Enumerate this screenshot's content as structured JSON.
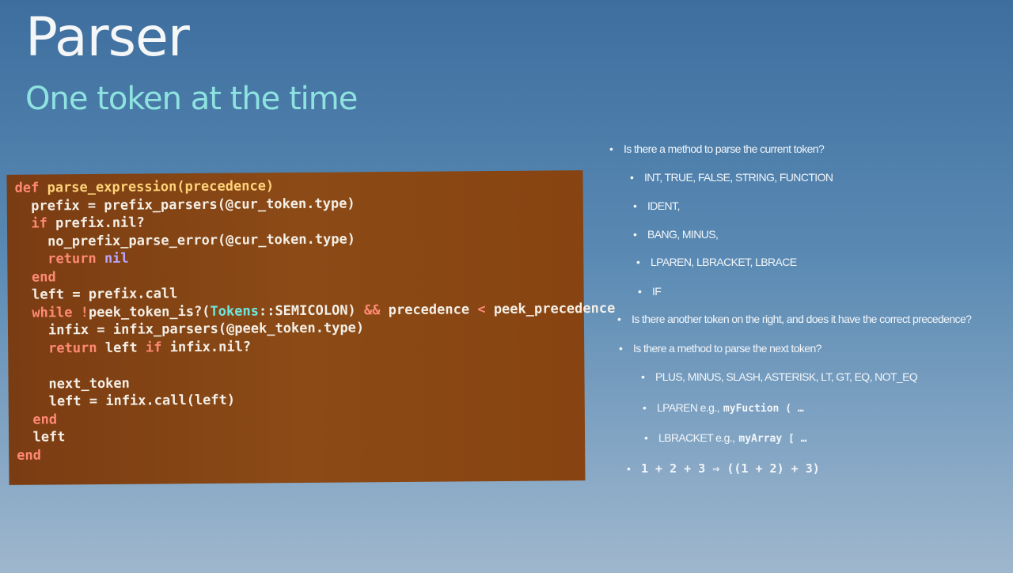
{
  "slide": {
    "title": "Parser",
    "subtitle": "One token at the time"
  },
  "colors": {
    "title": "#f4f6f8",
    "subtitle": "#8ee3e0",
    "code_background": "#8b4a16",
    "keyword": "#ff8a73",
    "function": "#ffd37a",
    "constant": "#6ee7e0",
    "nil": "#b9a6ff"
  },
  "code": [
    [
      {
        "t": "def ",
        "c": "kw"
      },
      {
        "t": "parse_expression(precedence)",
        "c": "fn"
      }
    ],
    [
      {
        "t": "  prefix = prefix_parsers(@cur_token.type)"
      }
    ],
    [
      {
        "t": "  if ",
        "c": "kw"
      },
      {
        "t": "prefix.nil?"
      }
    ],
    [
      {
        "t": "    no_prefix_parse_error(@cur_token.type)"
      }
    ],
    [
      {
        "t": "    return ",
        "c": "kw"
      },
      {
        "t": "nil",
        "c": "nl"
      }
    ],
    [
      {
        "t": "  end",
        "c": "kw"
      }
    ],
    [
      {
        "t": "  left = prefix.call"
      }
    ],
    [
      {
        "t": "  while ",
        "c": "kw"
      },
      {
        "t": "!",
        "c": "kw"
      },
      {
        "t": "peek_token_is?("
      },
      {
        "t": "Tokens",
        "c": "cy"
      },
      {
        "t": "::SEMICOLON) "
      },
      {
        "t": "&&",
        "c": "kw"
      },
      {
        "t": " precedence "
      },
      {
        "t": "<",
        "c": "kw"
      },
      {
        "t": " peek_precedence"
      }
    ],
    [
      {
        "t": "    infix = infix_parsers(@peek_token.type)"
      }
    ],
    [
      {
        "t": "    return ",
        "c": "kw"
      },
      {
        "t": "left "
      },
      {
        "t": "if ",
        "c": "kw"
      },
      {
        "t": "infix.nil?"
      }
    ],
    [
      {
        "t": ""
      }
    ],
    [
      {
        "t": "    next_token"
      }
    ],
    [
      {
        "t": "    left = infix.call(left)"
      }
    ],
    [
      {
        "t": "  end",
        "c": "kw"
      }
    ],
    [
      {
        "t": "  left"
      }
    ],
    [
      {
        "t": "end",
        "c": "kw"
      }
    ]
  ],
  "bullets": [
    {
      "text": "Is there a method to parse the current token?",
      "level": 0
    },
    {
      "text": "INT, TRUE, FALSE, STRING, FUNCTION",
      "level": 1
    },
    {
      "text": "IDENT,",
      "level": 1
    },
    {
      "text": "BANG, MINUS,",
      "level": 1
    },
    {
      "text": "LPAREN, LBRACKET, LBRACE",
      "level": 1
    },
    {
      "text": "IF",
      "level": 1
    },
    {
      "text": "Is there another token on the right, and does it have the correct precedence?",
      "level": 0
    },
    {
      "text": "Is there a method to parse the next token?",
      "level": 0
    },
    {
      "text": "PLUS, MINUS, SLASH, ASTERISK, LT, GT, EQ, NOT_EQ",
      "level": 1
    },
    {
      "text": "LPAREN e.g.,",
      "code": "myFuction ( …",
      "level": 1
    },
    {
      "text": "LBRACKET e.g.,",
      "code": "myArray [ …",
      "level": 1
    },
    {
      "text": "",
      "code": "1 + 2 + 3 ⇒ ((1 + 2) + 3)",
      "level": 0
    }
  ]
}
